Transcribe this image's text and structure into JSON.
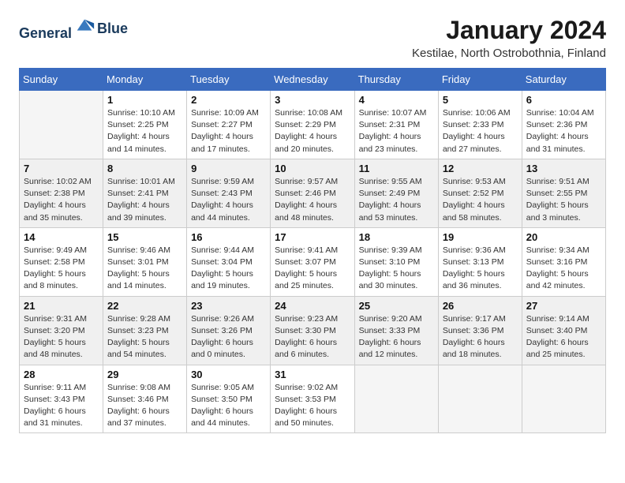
{
  "header": {
    "logo_line1": "General",
    "logo_line2": "Blue",
    "month_title": "January 2024",
    "location": "Kestilae, North Ostrobothnia, Finland"
  },
  "days_of_week": [
    "Sunday",
    "Monday",
    "Tuesday",
    "Wednesday",
    "Thursday",
    "Friday",
    "Saturday"
  ],
  "weeks": [
    [
      {
        "day": "",
        "info": ""
      },
      {
        "day": "1",
        "info": "Sunrise: 10:10 AM\nSunset: 2:25 PM\nDaylight: 4 hours\nand 14 minutes."
      },
      {
        "day": "2",
        "info": "Sunrise: 10:09 AM\nSunset: 2:27 PM\nDaylight: 4 hours\nand 17 minutes."
      },
      {
        "day": "3",
        "info": "Sunrise: 10:08 AM\nSunset: 2:29 PM\nDaylight: 4 hours\nand 20 minutes."
      },
      {
        "day": "4",
        "info": "Sunrise: 10:07 AM\nSunset: 2:31 PM\nDaylight: 4 hours\nand 23 minutes."
      },
      {
        "day": "5",
        "info": "Sunrise: 10:06 AM\nSunset: 2:33 PM\nDaylight: 4 hours\nand 27 minutes."
      },
      {
        "day": "6",
        "info": "Sunrise: 10:04 AM\nSunset: 2:36 PM\nDaylight: 4 hours\nand 31 minutes."
      }
    ],
    [
      {
        "day": "7",
        "info": "Sunrise: 10:02 AM\nSunset: 2:38 PM\nDaylight: 4 hours\nand 35 minutes."
      },
      {
        "day": "8",
        "info": "Sunrise: 10:01 AM\nSunset: 2:41 PM\nDaylight: 4 hours\nand 39 minutes."
      },
      {
        "day": "9",
        "info": "Sunrise: 9:59 AM\nSunset: 2:43 PM\nDaylight: 4 hours\nand 44 minutes."
      },
      {
        "day": "10",
        "info": "Sunrise: 9:57 AM\nSunset: 2:46 PM\nDaylight: 4 hours\nand 48 minutes."
      },
      {
        "day": "11",
        "info": "Sunrise: 9:55 AM\nSunset: 2:49 PM\nDaylight: 4 hours\nand 53 minutes."
      },
      {
        "day": "12",
        "info": "Sunrise: 9:53 AM\nSunset: 2:52 PM\nDaylight: 4 hours\nand 58 minutes."
      },
      {
        "day": "13",
        "info": "Sunrise: 9:51 AM\nSunset: 2:55 PM\nDaylight: 5 hours\nand 3 minutes."
      }
    ],
    [
      {
        "day": "14",
        "info": "Sunrise: 9:49 AM\nSunset: 2:58 PM\nDaylight: 5 hours\nand 8 minutes."
      },
      {
        "day": "15",
        "info": "Sunrise: 9:46 AM\nSunset: 3:01 PM\nDaylight: 5 hours\nand 14 minutes."
      },
      {
        "day": "16",
        "info": "Sunrise: 9:44 AM\nSunset: 3:04 PM\nDaylight: 5 hours\nand 19 minutes."
      },
      {
        "day": "17",
        "info": "Sunrise: 9:41 AM\nSunset: 3:07 PM\nDaylight: 5 hours\nand 25 minutes."
      },
      {
        "day": "18",
        "info": "Sunrise: 9:39 AM\nSunset: 3:10 PM\nDaylight: 5 hours\nand 30 minutes."
      },
      {
        "day": "19",
        "info": "Sunrise: 9:36 AM\nSunset: 3:13 PM\nDaylight: 5 hours\nand 36 minutes."
      },
      {
        "day": "20",
        "info": "Sunrise: 9:34 AM\nSunset: 3:16 PM\nDaylight: 5 hours\nand 42 minutes."
      }
    ],
    [
      {
        "day": "21",
        "info": "Sunrise: 9:31 AM\nSunset: 3:20 PM\nDaylight: 5 hours\nand 48 minutes."
      },
      {
        "day": "22",
        "info": "Sunrise: 9:28 AM\nSunset: 3:23 PM\nDaylight: 5 hours\nand 54 minutes."
      },
      {
        "day": "23",
        "info": "Sunrise: 9:26 AM\nSunset: 3:26 PM\nDaylight: 6 hours\nand 0 minutes."
      },
      {
        "day": "24",
        "info": "Sunrise: 9:23 AM\nSunset: 3:30 PM\nDaylight: 6 hours\nand 6 minutes."
      },
      {
        "day": "25",
        "info": "Sunrise: 9:20 AM\nSunset: 3:33 PM\nDaylight: 6 hours\nand 12 minutes."
      },
      {
        "day": "26",
        "info": "Sunrise: 9:17 AM\nSunset: 3:36 PM\nDaylight: 6 hours\nand 18 minutes."
      },
      {
        "day": "27",
        "info": "Sunrise: 9:14 AM\nSunset: 3:40 PM\nDaylight: 6 hours\nand 25 minutes."
      }
    ],
    [
      {
        "day": "28",
        "info": "Sunrise: 9:11 AM\nSunset: 3:43 PM\nDaylight: 6 hours\nand 31 minutes."
      },
      {
        "day": "29",
        "info": "Sunrise: 9:08 AM\nSunset: 3:46 PM\nDaylight: 6 hours\nand 37 minutes."
      },
      {
        "day": "30",
        "info": "Sunrise: 9:05 AM\nSunset: 3:50 PM\nDaylight: 6 hours\nand 44 minutes."
      },
      {
        "day": "31",
        "info": "Sunrise: 9:02 AM\nSunset: 3:53 PM\nDaylight: 6 hours\nand 50 minutes."
      },
      {
        "day": "",
        "info": ""
      },
      {
        "day": "",
        "info": ""
      },
      {
        "day": "",
        "info": ""
      }
    ]
  ]
}
